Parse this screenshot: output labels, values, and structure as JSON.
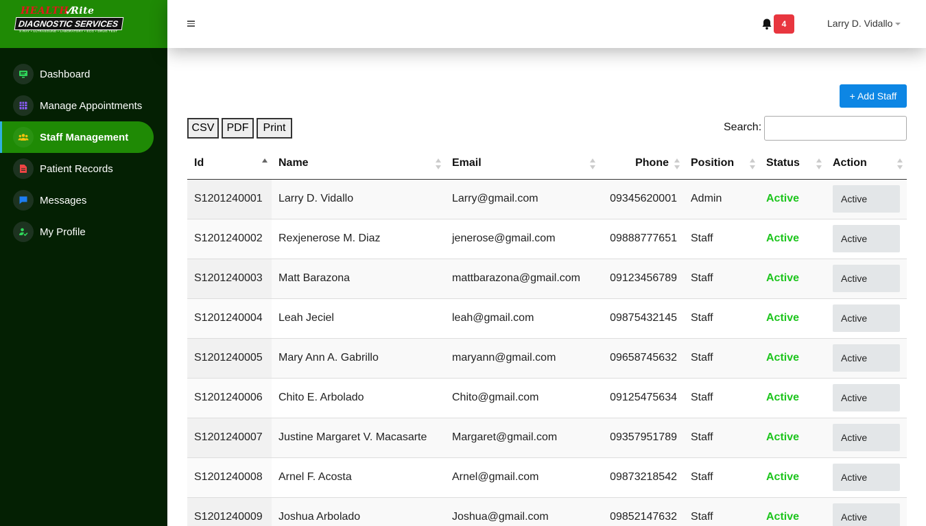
{
  "brand": {
    "logo_top_left": "HEALTH",
    "logo_top_right": "Rite",
    "logo_main": "DIAGNOSTIC SERVICES",
    "logo_tagline": "X-RAY • ULTRASOUND • LABORATORY • ECG • DRUG TEST"
  },
  "sidebar": {
    "items": [
      {
        "label": "Dashboard",
        "icon": "monitor-icon",
        "color": "#2fd65a"
      },
      {
        "label": "Manage Appointments",
        "icon": "calendar-grid-icon",
        "color": "#8b5cf6"
      },
      {
        "label": "Staff Management",
        "icon": "users-icon",
        "color": "#f4c20d"
      },
      {
        "label": "Patient Records",
        "icon": "document-icon",
        "color": "#ef4444"
      },
      {
        "label": "Messages",
        "icon": "chat-icon",
        "color": "#1d7df2"
      },
      {
        "label": "My Profile",
        "icon": "user-check-icon",
        "color": "#2fd65a"
      }
    ],
    "active_index": 2
  },
  "topbar": {
    "notification_count": "4",
    "user_name": "Larry D. Vidallo"
  },
  "toolbar": {
    "add_label": "+ Add Staff",
    "csv_label": "CSV",
    "pdf_label": "PDF",
    "print_label": "Print",
    "search_label": "Search:",
    "search_value": ""
  },
  "table": {
    "columns": [
      "Id",
      "Name",
      "Email",
      "Phone",
      "Position",
      "Status",
      "Action"
    ],
    "sorted_column": "Id",
    "rows": [
      {
        "id": "S1201240001",
        "name": "Larry D. Vidallo",
        "email": "Larry@gmail.com",
        "phone": "09345620001",
        "position": "Admin",
        "status": "Active",
        "action": "Active"
      },
      {
        "id": "S1201240002",
        "name": "Rexjenerose M. Diaz",
        "email": "jenerose@gmail.com",
        "phone": "09888777651",
        "position": "Staff",
        "status": "Active",
        "action": "Active"
      },
      {
        "id": "S1201240003",
        "name": "Matt Barazona",
        "email": "mattbarazona@gmail.com",
        "phone": "09123456789",
        "position": "Staff",
        "status": "Active",
        "action": "Active"
      },
      {
        "id": "S1201240004",
        "name": "Leah Jeciel",
        "email": "leah@gmail.com",
        "phone": "09875432145",
        "position": "Staff",
        "status": "Active",
        "action": "Active"
      },
      {
        "id": "S1201240005",
        "name": "Mary Ann A. Gabrillo",
        "email": "maryann@gmail.com",
        "phone": "09658745632",
        "position": "Staff",
        "status": "Active",
        "action": "Active"
      },
      {
        "id": "S1201240006",
        "name": "Chito E. Arbolado",
        "email": "Chito@gmail.com",
        "phone": "09125475634",
        "position": "Staff",
        "status": "Active",
        "action": "Active"
      },
      {
        "id": "S1201240007",
        "name": "Justine Margaret V. Macasarte",
        "email": "Margaret@gmail.com",
        "phone": "09357951789",
        "position": "Staff",
        "status": "Active",
        "action": "Active"
      },
      {
        "id": "S1201240008",
        "name": "Arnel F. Acosta",
        "email": "Arnel@gmail.com",
        "phone": "09873218542",
        "position": "Staff",
        "status": "Active",
        "action": "Active"
      },
      {
        "id": "S1201240009",
        "name": "Joshua Arbolado",
        "email": "Joshua@gmail.com",
        "phone": "09852147632",
        "position": "Staff",
        "status": "Active",
        "action": "Active"
      }
    ]
  },
  "colors": {
    "sidebar_bg": "#042003",
    "brand_green": "#1f8a05",
    "primary_button": "#0d86e4",
    "status_active": "#1cc51c",
    "badge_red": "#e8363f"
  }
}
